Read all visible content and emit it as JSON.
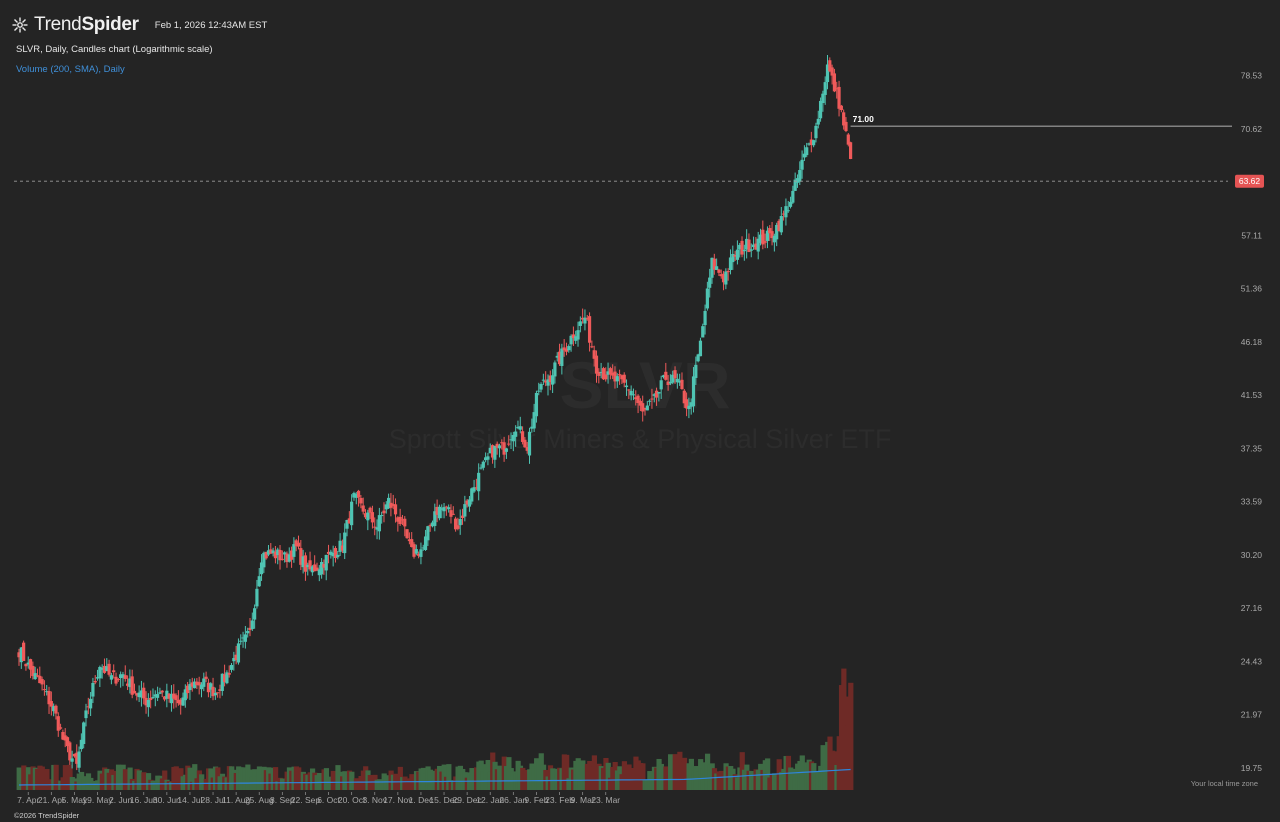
{
  "header": {
    "brand_light": "Trend",
    "brand_bold": "Spider",
    "timestamp": "Feb 1, 2026 12:43AM EST",
    "chart_title": "SLVR, Daily, Candles chart (Logarithmic scale)",
    "indicator": "Volume (200, SMA), Daily"
  },
  "footer": {
    "copyright": "©2026 TrendSpider",
    "timezone_note": "Your local time zone"
  },
  "colors": {
    "background": "#242424",
    "up": "#4fc4b3",
    "down": "#ef5a5a",
    "vol_up": "#3e6b45",
    "vol_down": "#6e2a26",
    "sma": "#2e86de",
    "last_price_tag": "#e55454",
    "text": "#d9d9d9",
    "axis_text": "#a8a8a8"
  },
  "chart_data": {
    "type": "candlestick",
    "symbol": "SLVR",
    "watermark": "SLVR",
    "watermark_sub": "Sprott Silver Miners & Physical Silver ETF",
    "scale": "log",
    "ylim": [
      18.9,
      86.0
    ],
    "y_ticks": [
      "78.53",
      "70.62",
      "63.62",
      "57.11",
      "51.36",
      "46.18",
      "41.53",
      "37.35",
      "33.59",
      "30.20",
      "27.16",
      "24.43",
      "21.97",
      "19.75"
    ],
    "x_ticks": [
      "7. Apr",
      "21. Apr",
      "5. May",
      "19. May",
      "2. Jun",
      "16. Jun",
      "30. Jun",
      "14. Jul",
      "28. Jul",
      "11. Aug",
      "25. Aug",
      "8. Sep",
      "22. Sep",
      "6. Oct",
      "20. Oct",
      "3. Nov",
      "17. Nov",
      "1. Dec",
      "15. Dec",
      "29. Dec",
      "12. Jan",
      "26. Jan",
      "9. Feb",
      "23. Feb",
      "9. Mar",
      "23. Mar"
    ],
    "x_tick_start_index": 4,
    "x_tick_step": 10,
    "last_price": 63.62,
    "last_price_label": "63.62",
    "level_line": 71.0,
    "level_label": "71.00",
    "close_path": [
      25.0,
      24.0,
      23.2,
      22.2,
      20.6,
      19.8,
      22.4,
      24.3,
      23.6,
      23.8,
      23.0,
      22.6,
      23.0,
      22.7,
      22.4,
      23.4,
      23.4,
      23.0,
      23.8,
      25.0,
      25.8,
      30.2,
      30.3,
      30.0,
      30.6,
      29.2,
      29.6,
      30.2,
      30.8,
      33.8,
      32.8,
      32.0,
      33.6,
      32.3,
      30.3,
      30.6,
      33.0,
      33.2,
      32.0,
      34.0,
      35.6,
      37.2,
      37.4,
      39.2,
      37.5,
      42.0,
      43.2,
      45.0,
      47.0,
      48.5,
      44.0,
      43.0,
      42.6,
      42.0,
      40.0,
      41.0,
      43.0,
      42.6,
      40.3,
      46.0,
      54.0,
      52.5,
      55.0,
      56.0,
      56.4,
      57.0,
      58.8,
      62.0,
      66.8,
      70.8,
      80.0,
      74.5,
      66.5
    ],
    "candles_per_segment": 5,
    "candle_count": 361,
    "volume_sma_path": [
      100,
      110,
      120,
      140,
      160
    ]
  }
}
